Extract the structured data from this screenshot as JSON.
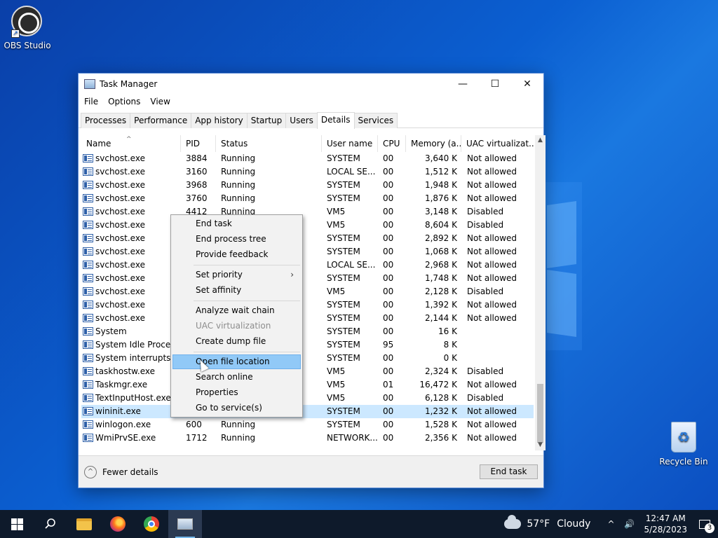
{
  "desktop": {
    "icons": [
      {
        "label": "OBS Studio"
      },
      {
        "label": "Recycle Bin"
      }
    ]
  },
  "window": {
    "title": "Task Manager",
    "controls": {
      "minimize": "—",
      "maximize": "☐",
      "close": "✕"
    },
    "menu": [
      "File",
      "Options",
      "View"
    ],
    "tabs": [
      "Processes",
      "Performance",
      "App history",
      "Startup",
      "Users",
      "Details",
      "Services"
    ],
    "active_tab": "Details",
    "columns": [
      "Name",
      "PID",
      "Status",
      "User name",
      "CPU",
      "Memory (a...",
      "UAC virtualizat..."
    ],
    "rows": [
      {
        "name": "svchost.exe",
        "pid": "3884",
        "status": "Running",
        "user": "SYSTEM",
        "cpu": "00",
        "mem": "3,640 K",
        "uac": "Not allowed"
      },
      {
        "name": "svchost.exe",
        "pid": "3160",
        "status": "Running",
        "user": "LOCAL SE...",
        "cpu": "00",
        "mem": "1,512 K",
        "uac": "Not allowed"
      },
      {
        "name": "svchost.exe",
        "pid": "3968",
        "status": "Running",
        "user": "SYSTEM",
        "cpu": "00",
        "mem": "1,948 K",
        "uac": "Not allowed"
      },
      {
        "name": "svchost.exe",
        "pid": "3760",
        "status": "Running",
        "user": "SYSTEM",
        "cpu": "00",
        "mem": "1,876 K",
        "uac": "Not allowed"
      },
      {
        "name": "svchost.exe",
        "pid": "4412",
        "status": "Running",
        "user": "VM5",
        "cpu": "00",
        "mem": "3,148 K",
        "uac": "Disabled"
      },
      {
        "name": "svchost.exe",
        "pid": "",
        "status": "",
        "user": "VM5",
        "cpu": "00",
        "mem": "8,604 K",
        "uac": "Disabled"
      },
      {
        "name": "svchost.exe",
        "pid": "",
        "status": "",
        "user": "SYSTEM",
        "cpu": "00",
        "mem": "2,892 K",
        "uac": "Not allowed"
      },
      {
        "name": "svchost.exe",
        "pid": "",
        "status": "",
        "user": "SYSTEM",
        "cpu": "00",
        "mem": "1,068 K",
        "uac": "Not allowed"
      },
      {
        "name": "svchost.exe",
        "pid": "",
        "status": "",
        "user": "LOCAL SE...",
        "cpu": "00",
        "mem": "2,968 K",
        "uac": "Not allowed"
      },
      {
        "name": "svchost.exe",
        "pid": "",
        "status": "",
        "user": "SYSTEM",
        "cpu": "00",
        "mem": "1,748 K",
        "uac": "Not allowed"
      },
      {
        "name": "svchost.exe",
        "pid": "",
        "status": "",
        "user": "VM5",
        "cpu": "00",
        "mem": "2,128 K",
        "uac": "Disabled"
      },
      {
        "name": "svchost.exe",
        "pid": "",
        "status": "",
        "user": "SYSTEM",
        "cpu": "00",
        "mem": "1,392 K",
        "uac": "Not allowed"
      },
      {
        "name": "svchost.exe",
        "pid": "",
        "status": "",
        "user": "SYSTEM",
        "cpu": "00",
        "mem": "2,144 K",
        "uac": "Not allowed"
      },
      {
        "name": "System",
        "pid": "",
        "status": "",
        "user": "SYSTEM",
        "cpu": "00",
        "mem": "16 K",
        "uac": ""
      },
      {
        "name": "System Idle Process",
        "pid": "",
        "status": "",
        "user": "SYSTEM",
        "cpu": "95",
        "mem": "8 K",
        "uac": ""
      },
      {
        "name": "System interrupts",
        "pid": "",
        "status": "",
        "user": "SYSTEM",
        "cpu": "00",
        "mem": "0 K",
        "uac": ""
      },
      {
        "name": "taskhostw.exe",
        "pid": "",
        "status": "",
        "user": "VM5",
        "cpu": "00",
        "mem": "2,324 K",
        "uac": "Disabled"
      },
      {
        "name": "Taskmgr.exe",
        "pid": "",
        "status": "",
        "user": "VM5",
        "cpu": "01",
        "mem": "16,472 K",
        "uac": "Not allowed"
      },
      {
        "name": "TextInputHost.exe",
        "pid": "",
        "status": "",
        "user": "VM5",
        "cpu": "00",
        "mem": "6,128 K",
        "uac": "Disabled"
      },
      {
        "name": "wininit.exe",
        "pid": "",
        "status": "",
        "user": "SYSTEM",
        "cpu": "00",
        "mem": "1,232 K",
        "uac": "Not allowed"
      },
      {
        "name": "winlogon.exe",
        "pid": "600",
        "status": "Running",
        "user": "SYSTEM",
        "cpu": "00",
        "mem": "1,528 K",
        "uac": "Not allowed"
      },
      {
        "name": "WmiPrvSE.exe",
        "pid": "1712",
        "status": "Running",
        "user": "NETWORK...",
        "cpu": "00",
        "mem": "2,356 K",
        "uac": "Not allowed"
      }
    ],
    "selected_row": 19,
    "footer": {
      "fewer_details": "Fewer details",
      "end_task": "End task"
    }
  },
  "context_menu": {
    "items": [
      {
        "label": "End task"
      },
      {
        "label": "End process tree"
      },
      {
        "label": "Provide feedback"
      },
      {
        "label": "Set priority",
        "submenu": "›"
      },
      {
        "label": "Set affinity"
      },
      {
        "label": "Analyze wait chain"
      },
      {
        "label": "UAC virtualization",
        "disabled": true
      },
      {
        "label": "Create dump file"
      },
      {
        "label": "Open file location",
        "hover": true
      },
      {
        "label": "Search online"
      },
      {
        "label": "Properties"
      },
      {
        "label": "Go to service(s)"
      }
    ]
  },
  "taskbar": {
    "weather": {
      "temp": "57°F",
      "condition": "Cloudy"
    },
    "clock": {
      "time": "12:47 AM",
      "date": "5/28/2023"
    },
    "notifications": "3",
    "tray_up_arrow": "^",
    "volume": "🔊"
  }
}
